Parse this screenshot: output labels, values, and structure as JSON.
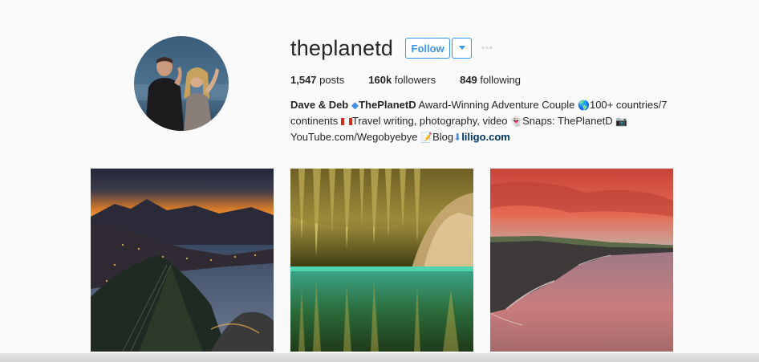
{
  "profile": {
    "username": "theplanetd",
    "follow_label": "Follow",
    "dropdown_icon": "chevron-down-icon",
    "more_icon": "more-options-icon",
    "more_label": "◦◦◦"
  },
  "stats": {
    "posts_count": "1,547",
    "posts_label": "posts",
    "followers_count": "160k",
    "followers_label": "followers",
    "following_count": "849",
    "following_label": "following"
  },
  "bio": {
    "name": "Dave & Deb",
    "diamond": "◆",
    "handle": "ThePlanetD",
    "text1": " Award-Winning Adventure Couple ",
    "globe": "🌎",
    "text2": "100+ countries/7 continents ",
    "text3": "Travel writing, photography, video ",
    "ghost": "👻",
    "text4": "Snaps: ThePlanetD ",
    "camera": "📷",
    "text5": "YouTube.com/Wegobyebye ",
    "memo": "📝",
    "text6": "Blog",
    "arrow": "⬇",
    "link": "liligo.com"
  },
  "photos": [
    {
      "name": "rio-sunset-photo"
    },
    {
      "name": "cave-lake-photo"
    },
    {
      "name": "cliffs-sunset-photo"
    }
  ],
  "colors": {
    "accent": "#3897f0",
    "link": "#003569",
    "background": "#fafafa",
    "text": "#262626"
  }
}
